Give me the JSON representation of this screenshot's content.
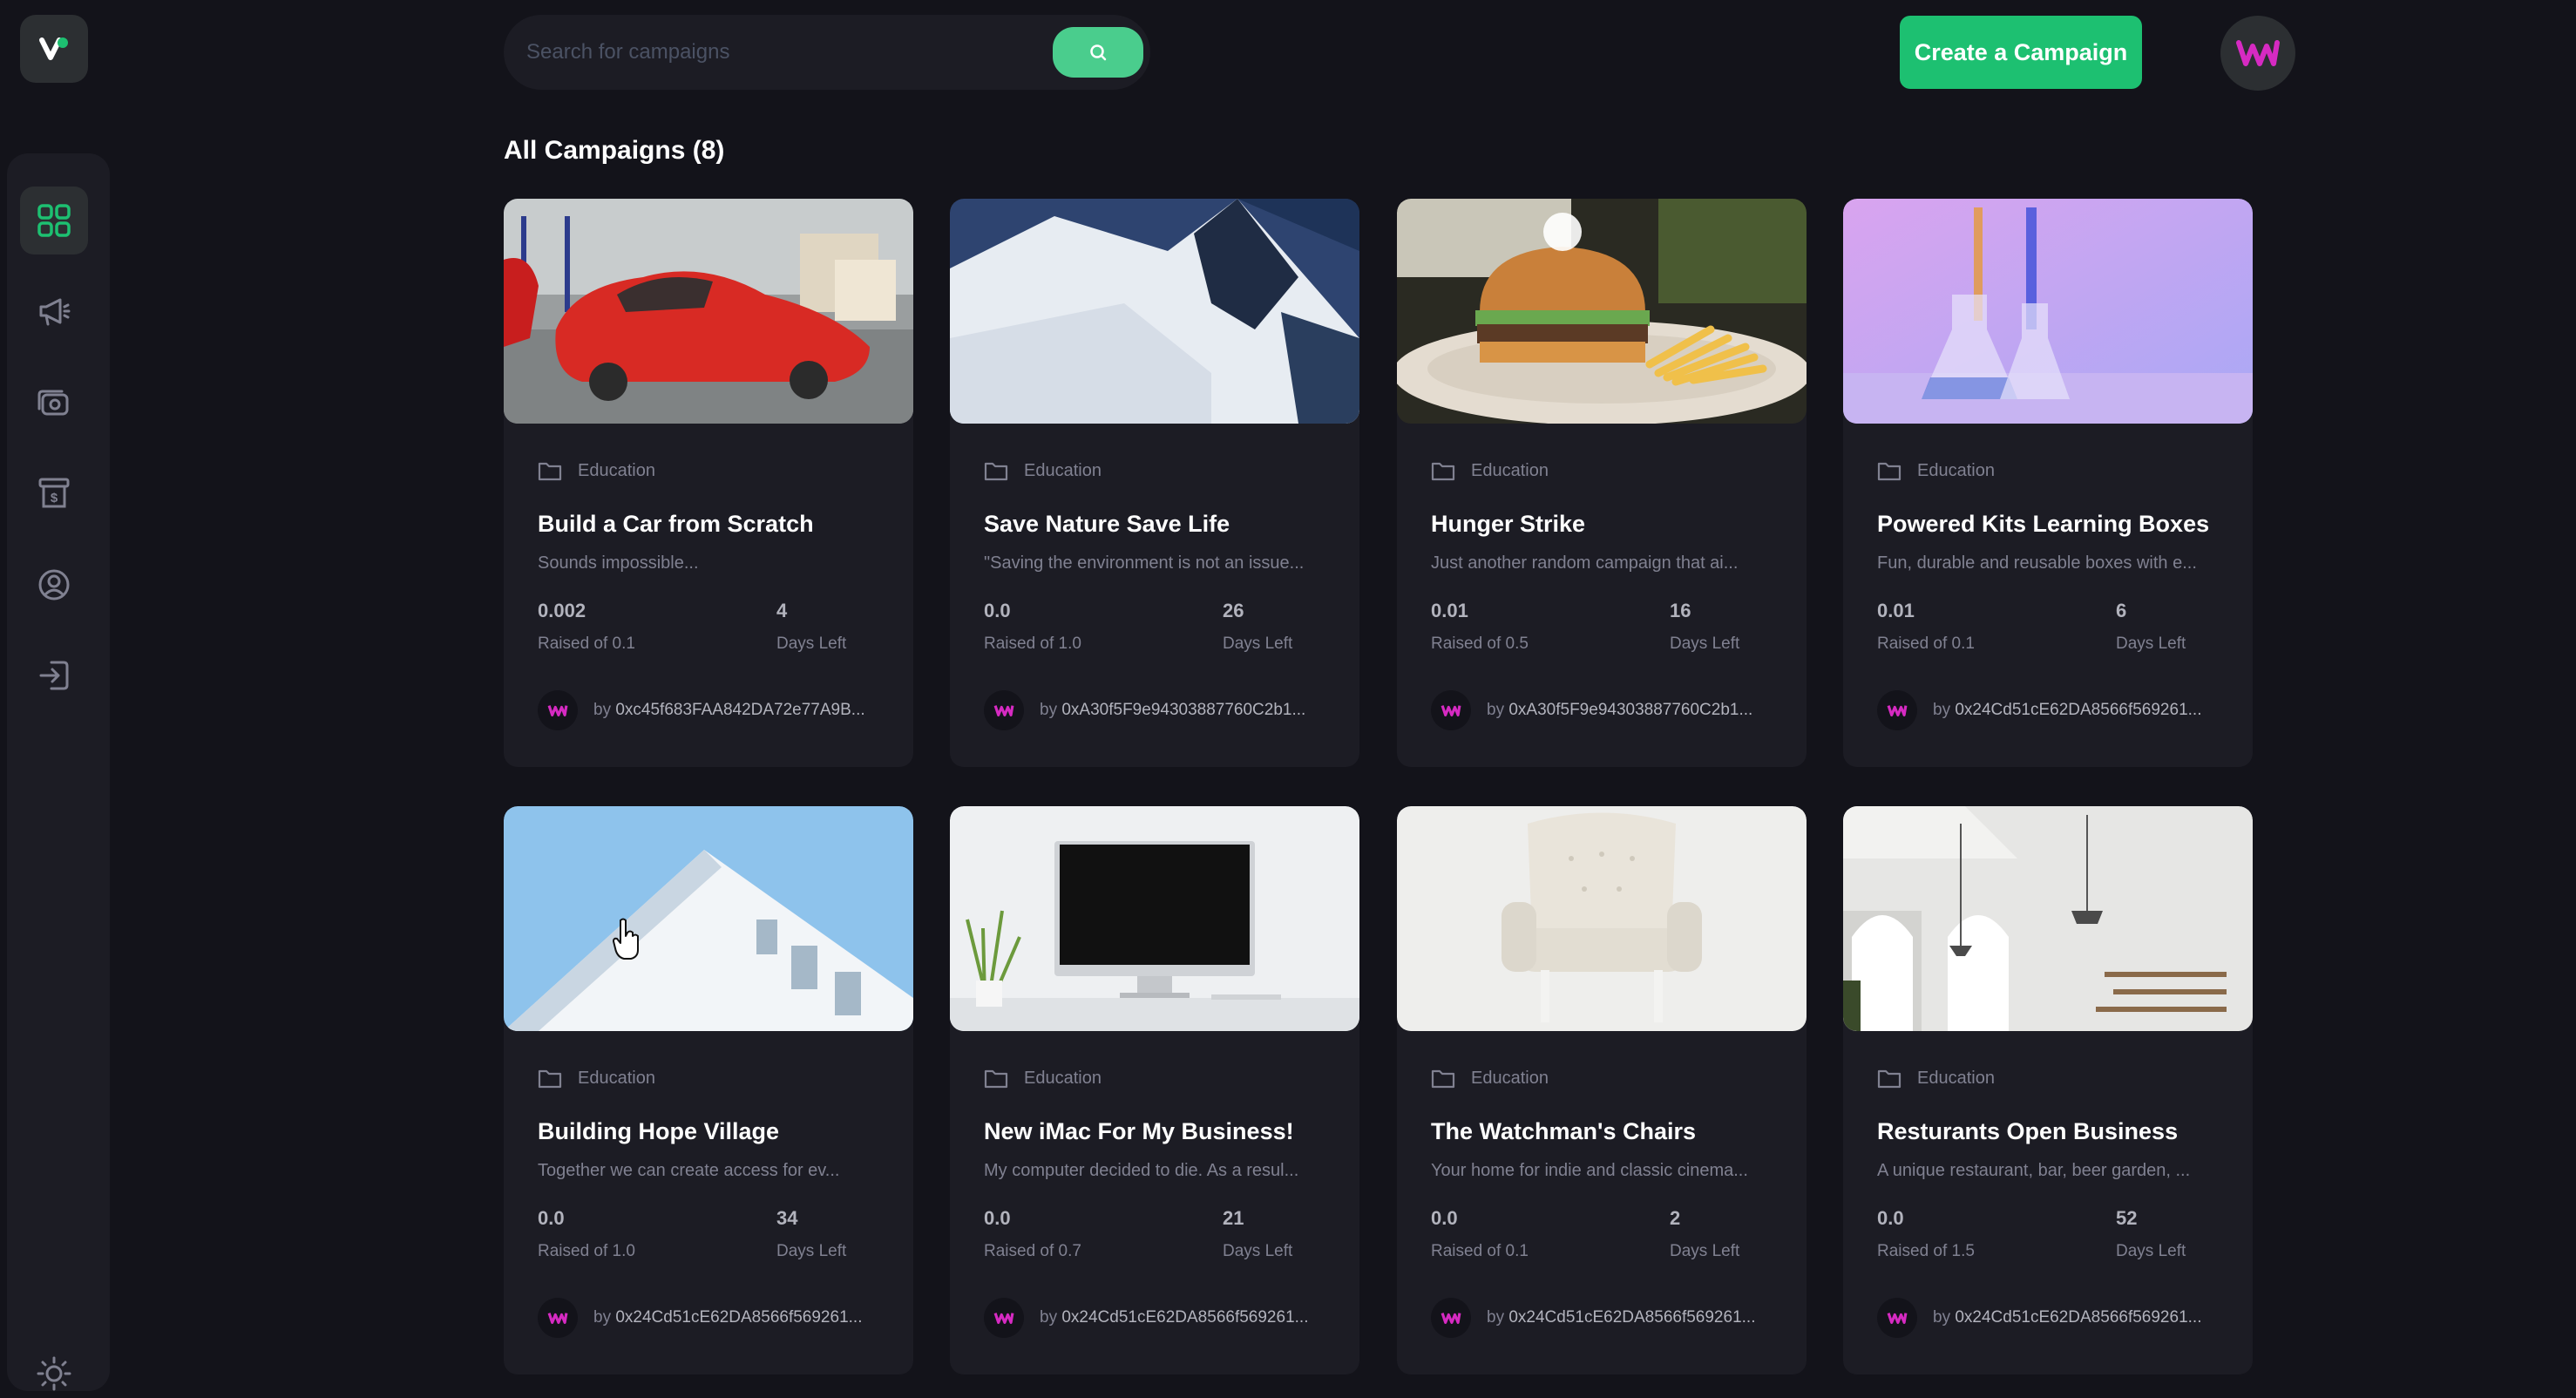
{
  "brand": {
    "logo_icon": "logo-icon",
    "accent": "#1dc071"
  },
  "sidebar": {
    "items": [
      {
        "name": "dashboard",
        "icon": "dashboard-grid-icon",
        "active": true
      },
      {
        "name": "campaign",
        "icon": "megaphone-icon",
        "active": false
      },
      {
        "name": "payment",
        "icon": "payment-icon",
        "active": false
      },
      {
        "name": "withdraw",
        "icon": "withdraw-icon",
        "active": false
      },
      {
        "name": "profile",
        "icon": "profile-icon",
        "active": false
      },
      {
        "name": "logout",
        "icon": "logout-icon",
        "active": false
      }
    ],
    "theme_toggle_icon": "sun-icon"
  },
  "header": {
    "search_placeholder": "Search for campaigns",
    "search_icon": "search-icon",
    "create_label": "Create a Campaign"
  },
  "main": {
    "title": "All Campaigns (8)"
  },
  "campaigns": [
    {
      "category": "Education",
      "title": "Build a Car from Scratch",
      "description": "Sounds impossible...",
      "raised": "0.002",
      "raised_label": "Raised of 0.1",
      "days": "4",
      "days_label": "Days Left",
      "by": "by",
      "owner": "0xc45f683FAA842DA72e77A9B..."
    },
    {
      "category": "Education",
      "title": "Save Nature Save Life",
      "description": "\"Saving the environment is not an issue...",
      "raised": "0.0",
      "raised_label": "Raised of 1.0",
      "days": "26",
      "days_label": "Days Left",
      "by": "by",
      "owner": "0xA30f5F9e94303887760C2b1..."
    },
    {
      "category": "Education",
      "title": "Hunger Strike",
      "description": "Just another random campaign that ai...",
      "raised": "0.01",
      "raised_label": "Raised of 0.5",
      "days": "16",
      "days_label": "Days Left",
      "by": "by",
      "owner": "0xA30f5F9e94303887760C2b1..."
    },
    {
      "category": "Education",
      "title": "Powered Kits Learning Boxes",
      "description": "Fun, durable and reusable boxes with e...",
      "raised": "0.01",
      "raised_label": "Raised of 0.1",
      "days": "6",
      "days_label": "Days Left",
      "by": "by",
      "owner": "0x24Cd51cE62DA8566f569261..."
    },
    {
      "category": "Education",
      "title": "Building Hope Village",
      "description": "Together we can create access for ev...",
      "raised": "0.0",
      "raised_label": "Raised of 1.0",
      "days": "34",
      "days_label": "Days Left",
      "by": "by",
      "owner": "0x24Cd51cE62DA8566f569261..."
    },
    {
      "category": "Education",
      "title": "New iMac For My Business!",
      "description": "My computer decided to die. As a resul...",
      "raised": "0.0",
      "raised_label": "Raised of 0.7",
      "days": "21",
      "days_label": "Days Left",
      "by": "by",
      "owner": "0x24Cd51cE62DA8566f569261..."
    },
    {
      "category": "Education",
      "title": "The Watchman's Chairs",
      "description": "Your home for indie and classic cinema...",
      "raised": "0.0",
      "raised_label": "Raised of 0.1",
      "days": "2",
      "days_label": "Days Left",
      "by": "by",
      "owner": "0x24Cd51cE62DA8566f569261..."
    },
    {
      "category": "Education",
      "title": "Resturants Open Business",
      "description": "A unique restaurant, bar, beer garden, ...",
      "raised": "0.0",
      "raised_label": "Raised of 1.5",
      "days": "52",
      "days_label": "Days Left",
      "by": "by",
      "owner": "0x24Cd51cE62DA8566f569261..."
    }
  ]
}
